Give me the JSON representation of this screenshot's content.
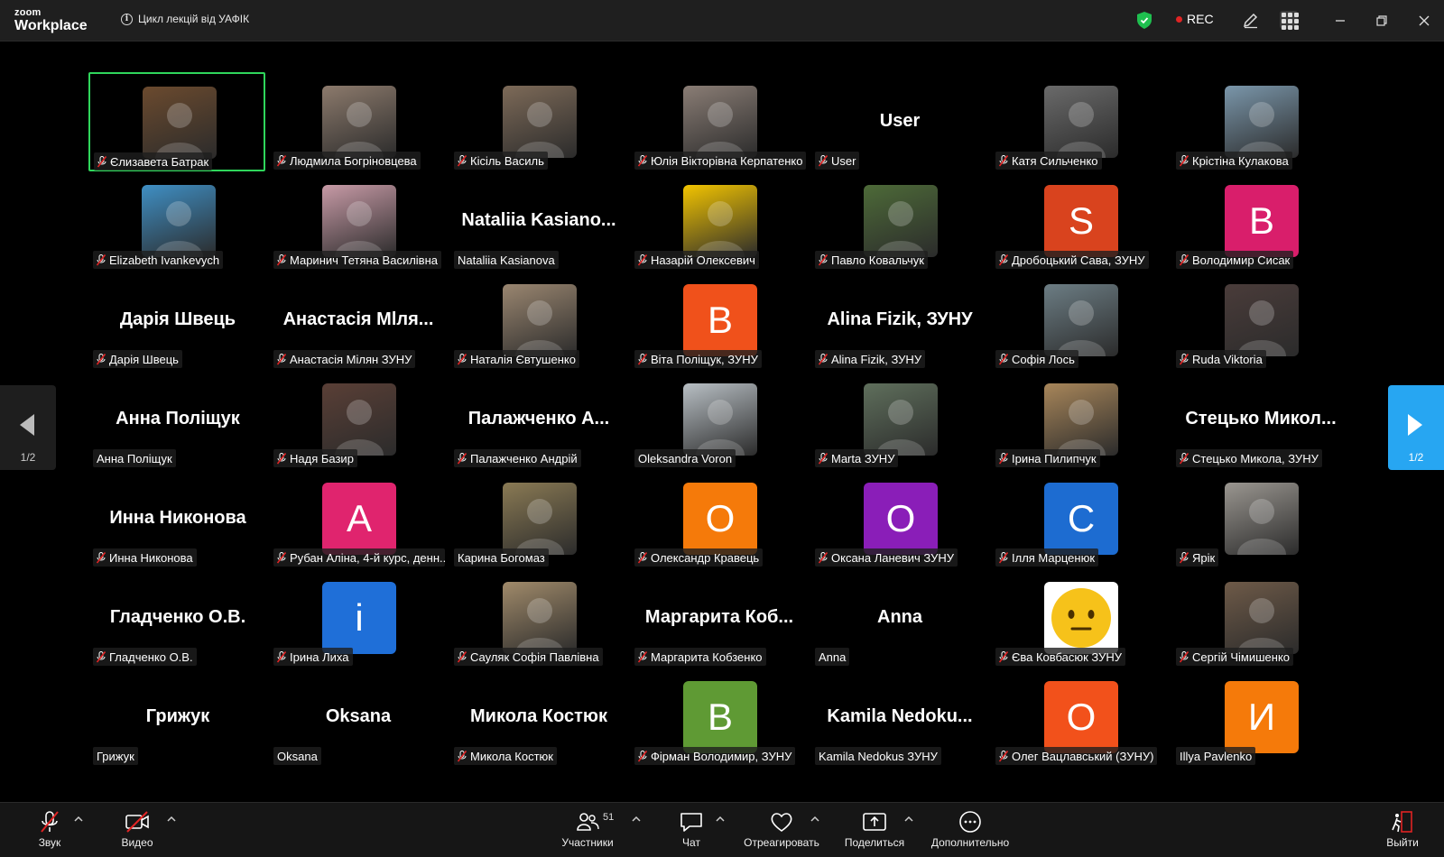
{
  "app": {
    "logo_top": "zoom",
    "logo_bottom": "Workplace",
    "meeting_title": "Цикл лекцій від УАФІК",
    "rec_label": "REC",
    "colors": {
      "accent_green": "#2fd65b",
      "rec_red": "#e02424",
      "pager_blue": "#27a6f2"
    }
  },
  "pagers": {
    "left_count": "1/2",
    "right_count": "1/2"
  },
  "participants": [
    {
      "label": "Єлизавета Батрак",
      "muted": true,
      "kind": "photo",
      "color": "#6b4a2e",
      "active": true
    },
    {
      "label": "Людмила Богріновцева",
      "muted": true,
      "kind": "photo",
      "color": "#8c7a6c"
    },
    {
      "label": "Кісіль Василь",
      "muted": true,
      "kind": "photo",
      "color": "#7d6a58"
    },
    {
      "label": "Юлія Вікторівна Керпатенко",
      "muted": true,
      "kind": "photo",
      "color": "#8a7d75"
    },
    {
      "label": "User",
      "muted": true,
      "kind": "name",
      "big": "User"
    },
    {
      "label": "Катя Сильченко",
      "muted": true,
      "kind": "photo",
      "color": "#6a6a6a"
    },
    {
      "label": "Крістіна Кулакова",
      "muted": true,
      "kind": "photo",
      "color": "#7a96aa"
    },
    {
      "label": "Elizabeth Ivankevych",
      "muted": true,
      "kind": "photo",
      "color": "#3f8fc4"
    },
    {
      "label": "Маринич Тетяна Василівна",
      "muted": true,
      "kind": "photo",
      "color": "#c79aa6"
    },
    {
      "label": "Nataliia Kasianova",
      "muted": false,
      "kind": "name",
      "big": "Nataliia Kasiano..."
    },
    {
      "label": "Назарій Олексевич",
      "muted": true,
      "kind": "photo",
      "color": "#f2c400"
    },
    {
      "label": "Павло Ковальчук",
      "muted": true,
      "kind": "photo",
      "color": "#4d6a38"
    },
    {
      "label": "Дробоцький Сава, ЗУНУ",
      "muted": true,
      "kind": "letter",
      "letter": "S",
      "color": "#d9431e"
    },
    {
      "label": "Володимир Сисак",
      "muted": true,
      "kind": "letter",
      "letter": "В",
      "color": "#d91e6b"
    },
    {
      "label": "Дарія Швець",
      "muted": true,
      "kind": "name",
      "big": "Дарія Швець"
    },
    {
      "label": "Анастасія Мілян ЗУНУ",
      "muted": true,
      "kind": "name",
      "big": "Анастасія Мlля..."
    },
    {
      "label": "Наталія Євтушенко",
      "muted": true,
      "kind": "photo",
      "color": "#9a8670"
    },
    {
      "label": "Віта Поліщук, ЗУНУ",
      "muted": true,
      "kind": "letter",
      "letter": "В",
      "color": "#f0511b"
    },
    {
      "label": "Alina Fizik, ЗУНУ",
      "muted": true,
      "kind": "name",
      "big": "Alina Fizik, ЗУНУ"
    },
    {
      "label": "Софія Лось",
      "muted": true,
      "kind": "photo",
      "color": "#6c7d84"
    },
    {
      "label": "Ruda Viktoria",
      "muted": true,
      "kind": "photo",
      "color": "#4a3c3a"
    },
    {
      "label": "Анна Поліщук",
      "muted": false,
      "kind": "name",
      "big": "Анна Поліщук"
    },
    {
      "label": "Надя Базир",
      "muted": true,
      "kind": "photo",
      "color": "#5a3f36"
    },
    {
      "label": "Палажченко Андрій",
      "muted": true,
      "kind": "name",
      "big": "Палажченко А..."
    },
    {
      "label": "Oleksandra Voron",
      "muted": false,
      "kind": "photo",
      "color": "#b8bfc4"
    },
    {
      "label": "Marta ЗУНУ",
      "muted": true,
      "kind": "photo",
      "color": "#5f6f5c"
    },
    {
      "label": "Ірина Пилипчук",
      "muted": true,
      "kind": "photo",
      "color": "#a8865a"
    },
    {
      "label": "Стецько Микола, ЗУНУ",
      "muted": true,
      "kind": "name",
      "big": "Стецько Микол..."
    },
    {
      "label": "Инна Никонова",
      "muted": true,
      "kind": "name",
      "big": "Инна Никонова"
    },
    {
      "label": "Рубан Аліна, 4-й курс,  денн...",
      "muted": true,
      "kind": "letter",
      "letter": "A",
      "color": "#e0246e"
    },
    {
      "label": "Карина Богомаз",
      "muted": false,
      "kind": "photo",
      "color": "#8a7a54"
    },
    {
      "label": "Олександр Кравець",
      "muted": true,
      "kind": "letter",
      "letter": "O",
      "color": "#f57a0a"
    },
    {
      "label": "Оксана Ланевич ЗУНУ",
      "muted": true,
      "kind": "letter",
      "letter": "O",
      "color": "#8a1eb8"
    },
    {
      "label": "Ілля Марценюк",
      "muted": true,
      "kind": "letter",
      "letter": "C",
      "color": "#1d6cd1"
    },
    {
      "label": "Ярік",
      "muted": true,
      "kind": "photo",
      "color": "#9a9690"
    },
    {
      "label": "Гладченко О.В.",
      "muted": true,
      "kind": "name",
      "big": "Гладченко О.В."
    },
    {
      "label": "Ірина Лиха",
      "muted": true,
      "kind": "letter",
      "letter": "i",
      "color": "#1f6fd8"
    },
    {
      "label": "Сауляк Софія Павлівна",
      "muted": true,
      "kind": "photo",
      "color": "#a08a6a"
    },
    {
      "label": "Маргарита Кобзенко",
      "muted": true,
      "kind": "name",
      "big": "Маргарита Коб..."
    },
    {
      "label": "Anna",
      "muted": false,
      "kind": "name",
      "big": "Anna"
    },
    {
      "label": "Єва Ковбасюк ЗУНУ",
      "muted": true,
      "kind": "emoji",
      "color": "#ffffff"
    },
    {
      "label": "Сергій Чімишенко",
      "muted": true,
      "kind": "photo",
      "color": "#6e5a48"
    },
    {
      "label": "Грижук",
      "muted": false,
      "kind": "name",
      "big": "Грижук"
    },
    {
      "label": "Oksana",
      "muted": false,
      "kind": "name",
      "big": "Oksana"
    },
    {
      "label": "Микола Костюк",
      "muted": true,
      "kind": "name",
      "big": "Микола Костюк"
    },
    {
      "label": "Фірман Володимир, ЗУНУ",
      "muted": true,
      "kind": "letter",
      "letter": "B",
      "color": "#5f9a34"
    },
    {
      "label": "Kamila Nedokus ЗУНУ",
      "muted": false,
      "kind": "name",
      "big": "Kamila  Nedoku..."
    },
    {
      "label": "Олег Вацлавський (ЗУНУ)",
      "muted": true,
      "kind": "letter",
      "letter": "O",
      "color": "#f2511b"
    },
    {
      "label": "Illya Pavlenko",
      "muted": false,
      "kind": "letter",
      "letter": "И",
      "color": "#f57a0a"
    }
  ],
  "toolbar": {
    "audio": "Звук",
    "video": "Видео",
    "participants": "Участники",
    "participants_count": "51",
    "chat": "Чат",
    "react": "Отреагировать",
    "share": "Поделиться",
    "more": "Дополнительно",
    "leave": "Выйти"
  }
}
